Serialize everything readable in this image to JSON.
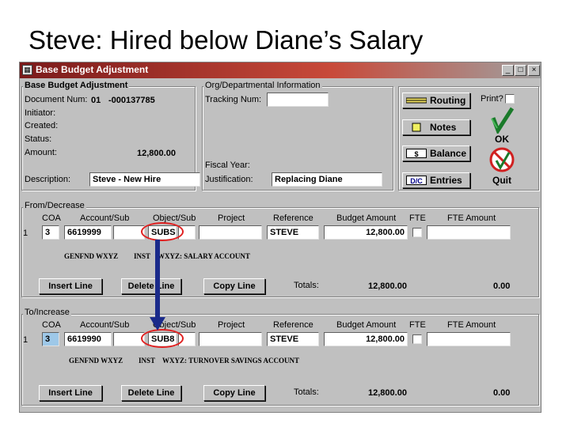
{
  "slide": {
    "title": "Steve: Hired below Diane’s Salary"
  },
  "window": {
    "title": "Base Budget Adjustment",
    "controls": {
      "minimize": "_",
      "maximize": "□",
      "close": "×"
    }
  },
  "header_group": {
    "title": "Base Budget Adjustment",
    "document_num_label": "Document Num:",
    "document_num_prefix": "01",
    "document_num": "-000137785",
    "initiator_label": "Initiator:",
    "created_label": "Created:",
    "status_label": "Status:",
    "amount_label": "Amount:",
    "amount": "12,800.00",
    "description_label": "Description:",
    "description": "Steve - New Hire"
  },
  "org_group": {
    "title": "Org/Departmental Information",
    "tracking_label": "Tracking Num:",
    "tracking": "",
    "fiscal_year_label": "Fiscal Year:",
    "justification_label": "Justification:",
    "justification": "Replacing Diane"
  },
  "actions": {
    "routing": "Routing",
    "notes": "Notes",
    "balance": "Balance",
    "entries": "Entries",
    "balance_icon": "$",
    "entries_icon": "D/C",
    "print_label": "Print?",
    "ok": "OK",
    "quit": "Quit"
  },
  "columns": {
    "coa": "COA",
    "account": "Account/Sub",
    "object": "Object/Sub",
    "project": "Project",
    "reference": "Reference",
    "budget": "Budget Amount",
    "fte": "FTE",
    "fte_amount": "FTE Amount"
  },
  "from_section": {
    "title": "From/Decrease",
    "row_num": "1",
    "coa": "3",
    "account": "6619999",
    "object": "SUBS",
    "project": "",
    "reference": "STEVE",
    "budget": "12,800.00",
    "fte_amount": "",
    "desc_fund": "GENFND WXYZ",
    "desc_inst": "INST",
    "desc_account": "WXYZ: SALARY ACCOUNT",
    "insert_label": "Insert Line",
    "delete_label": "Delete Line",
    "copy_label": "Copy Line",
    "totals_label": "Totals:",
    "total_budget": "12,800.00",
    "total_fte": "0.00"
  },
  "to_section": {
    "title": "To/Increase",
    "row_num": "1",
    "coa": "3",
    "account": "6619990",
    "object": "SUB8",
    "project": "",
    "reference": "STEVE",
    "budget": "12,800.00",
    "fte_amount": "",
    "desc_fund": "GENFND WXYZ",
    "desc_inst": "INST",
    "desc_account": "WXYZ: TURNOVER SAVINGS ACCOUNT",
    "insert_label": "Insert Line",
    "delete_label": "Delete Line",
    "copy_label": "Copy Line",
    "totals_label": "Totals:",
    "total_budget": "12,800.00",
    "total_fte": "0.00"
  },
  "colors": {
    "annotation_circle": "#e02020",
    "annotation_arrow": "#1a2a8a",
    "highlight_field": "#9ec8e8"
  }
}
